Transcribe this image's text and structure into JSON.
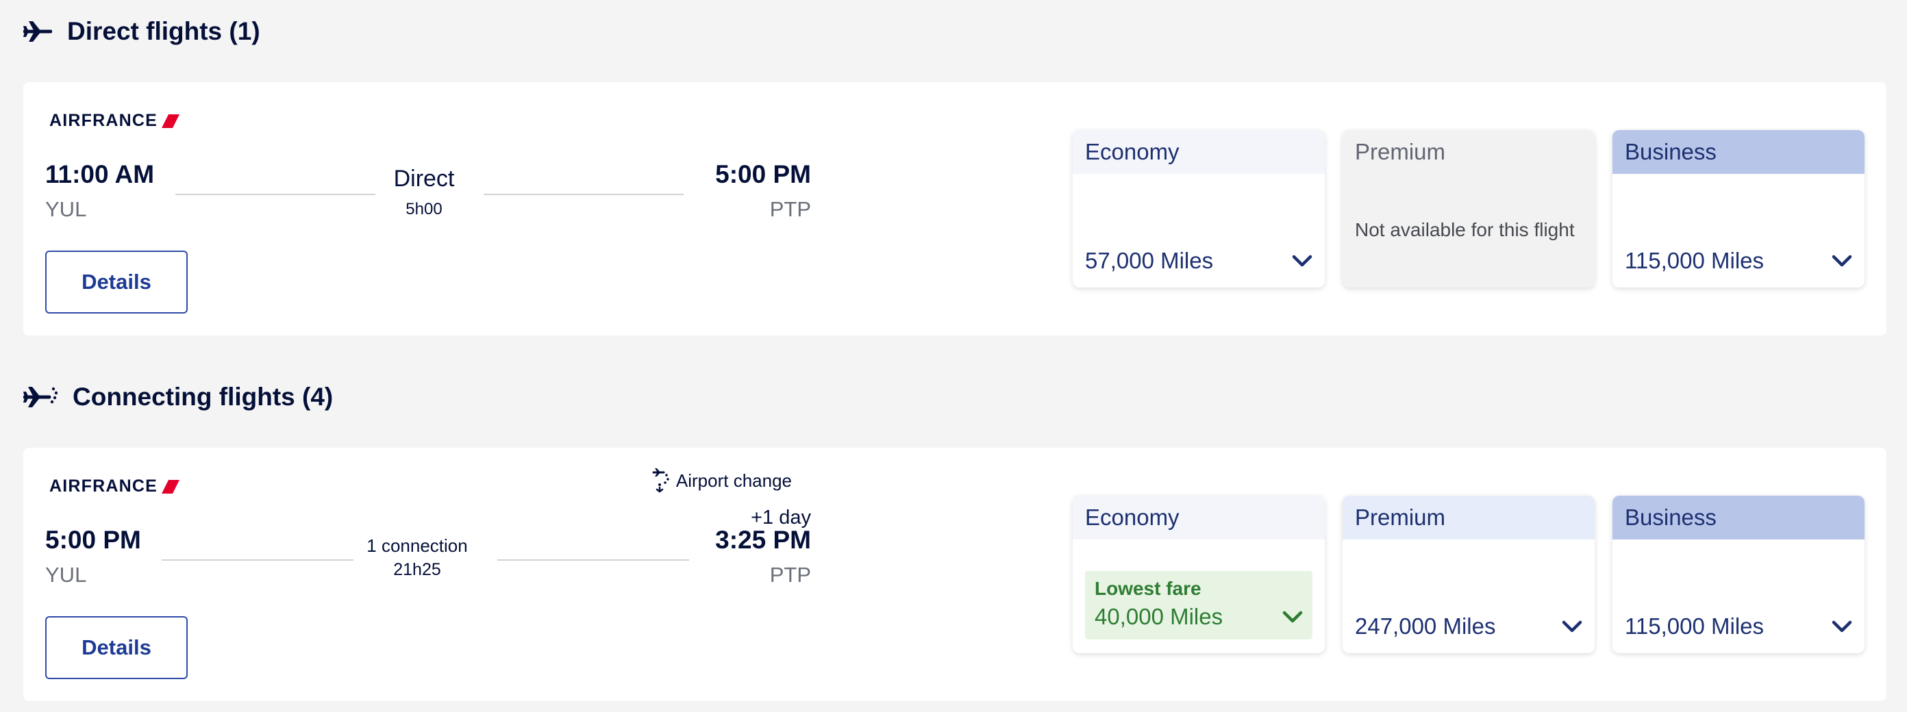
{
  "direct_section": {
    "title": "Direct flights (1)",
    "icon": "plane-icon"
  },
  "connecting_section": {
    "title": "Connecting flights (4)",
    "icon": "connecting-plane-icon"
  },
  "flights": [
    {
      "airline": "AIRFRANCE",
      "departure_time": "11:00 AM",
      "departure_airport": "YUL",
      "arrival_time": "5:00 PM",
      "arrival_airport": "PTP",
      "stops_label": "Direct",
      "duration": "5h00",
      "details_label": "Details",
      "fares": {
        "economy": {
          "label": "Economy",
          "price": "57,000 Miles"
        },
        "premium": {
          "label": "Premium",
          "unavailable_text": "Not available for this flight"
        },
        "business": {
          "label": "Business",
          "price": "115,000 Miles"
        }
      }
    },
    {
      "airline": "AIRFRANCE",
      "airport_change": "Airport change",
      "departure_time": "5:00 PM",
      "departure_airport": "YUL",
      "day_offset": "+1 day",
      "arrival_time": "3:25 PM",
      "arrival_airport": "PTP",
      "stops_label": "1 connection",
      "duration": "21h25",
      "details_label": "Details",
      "fares": {
        "economy": {
          "label": "Economy",
          "badge": "Lowest fare",
          "price": "40,000 Miles"
        },
        "premium": {
          "label": "Premium",
          "price": "247,000 Miles"
        },
        "business": {
          "label": "Business",
          "price": "115,000 Miles"
        }
      }
    }
  ],
  "colors": {
    "brand_navy": "#051039",
    "button_blue": "#1d3a94",
    "airfrance_red": "#e4002b",
    "lowest_fare_green": "#2e7d32",
    "business_header": "#b7c5e9"
  }
}
